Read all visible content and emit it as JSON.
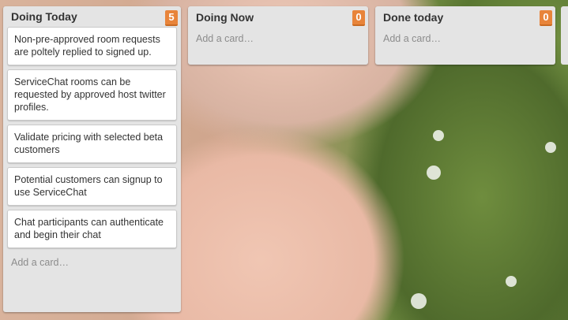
{
  "lists": [
    {
      "title": "Doing Today",
      "count": "5",
      "cards": [
        "Non-pre-approved room requests are poltely replied to signed up.",
        "ServiceChat rooms can be requested by approved host twitter profiles.",
        "Validate pricing with selected beta customers",
        "Potential customers can signup to use ServiceChat",
        "Chat participants can authenticate and begin their chat"
      ],
      "add_card": "Add a card…"
    },
    {
      "title": "Doing Now",
      "count": "0",
      "cards": [],
      "add_card": "Add a card…"
    },
    {
      "title": "Done today",
      "count": "0",
      "cards": [],
      "add_card": "Add a card…"
    }
  ],
  "colors": {
    "badge": "#e8843a",
    "list_bg": "#e4e4e4"
  }
}
